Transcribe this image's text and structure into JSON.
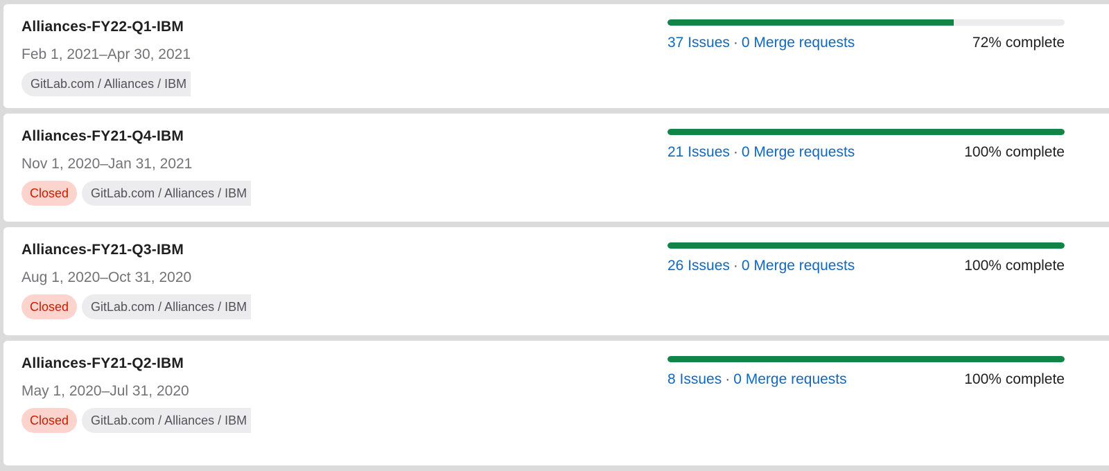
{
  "milestones": [
    {
      "title": "Alliances-FY22-Q1-IBM",
      "dates": "Feb 1, 2021–Apr 30, 2021",
      "status": null,
      "path": "GitLab.com / Alliances / IBM",
      "issues_label": "37 Issues",
      "separator": "·",
      "mr_label": "0 Merge requests",
      "progress_percent": 72,
      "progress_label": "72% complete"
    },
    {
      "title": "Alliances-FY21-Q4-IBM",
      "dates": "Nov 1, 2020–Jan 31, 2021",
      "status": "Closed",
      "path": "GitLab.com / Alliances / IBM",
      "issues_label": "21 Issues",
      "separator": "·",
      "mr_label": "0 Merge requests",
      "progress_percent": 100,
      "progress_label": "100% complete"
    },
    {
      "title": "Alliances-FY21-Q3-IBM",
      "dates": "Aug 1, 2020–Oct 31, 2020",
      "status": "Closed",
      "path": "GitLab.com / Alliances / IBM",
      "issues_label": "26 Issues",
      "separator": "·",
      "mr_label": "0 Merge requests",
      "progress_percent": 100,
      "progress_label": "100% complete"
    },
    {
      "title": "Alliances-FY21-Q2-IBM",
      "dates": "May 1, 2020–Jul 31, 2020",
      "status": "Closed",
      "path": "GitLab.com / Alliances / IBM",
      "issues_label": "8 Issues",
      "separator": "·",
      "mr_label": "0 Merge requests",
      "progress_percent": 100,
      "progress_label": "100% complete"
    }
  ],
  "colors": {
    "progress_fill": "#108548",
    "progress_track": "#ececef",
    "link": "#1068bf",
    "closed_badge_bg": "#fdd4cd",
    "closed_badge_text": "#c91c00"
  }
}
